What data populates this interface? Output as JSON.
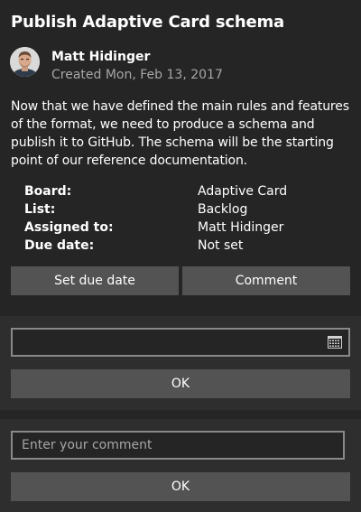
{
  "card": {
    "title": "Publish Adaptive Card schema",
    "author": "Matt Hidinger",
    "created": "Created Mon, Feb 13, 2017",
    "description": "Now that we have defined the main rules and features of the format, we need to produce a schema and publish it to GitHub. The schema will be the starting point of our reference documentation.",
    "facts": [
      {
        "title": "Board:",
        "value": "Adaptive Card"
      },
      {
        "title": "List:",
        "value": "Backlog"
      },
      {
        "title": "Assigned to:",
        "value": "Matt Hidinger"
      },
      {
        "title": "Due date:",
        "value": "Not set"
      }
    ],
    "actions": {
      "set_due_date": "Set due date",
      "comment": "Comment"
    }
  },
  "due_date_panel": {
    "date_value": "",
    "icon": "calendar-icon",
    "ok_label": "OK"
  },
  "comment_panel": {
    "placeholder": "Enter your comment",
    "ok_label": "OK"
  },
  "colors": {
    "background": "#252525",
    "panel": "#2e2e2e",
    "button": "#535353",
    "input_border": "#898989",
    "secondary_text": "#a6a6a6"
  }
}
